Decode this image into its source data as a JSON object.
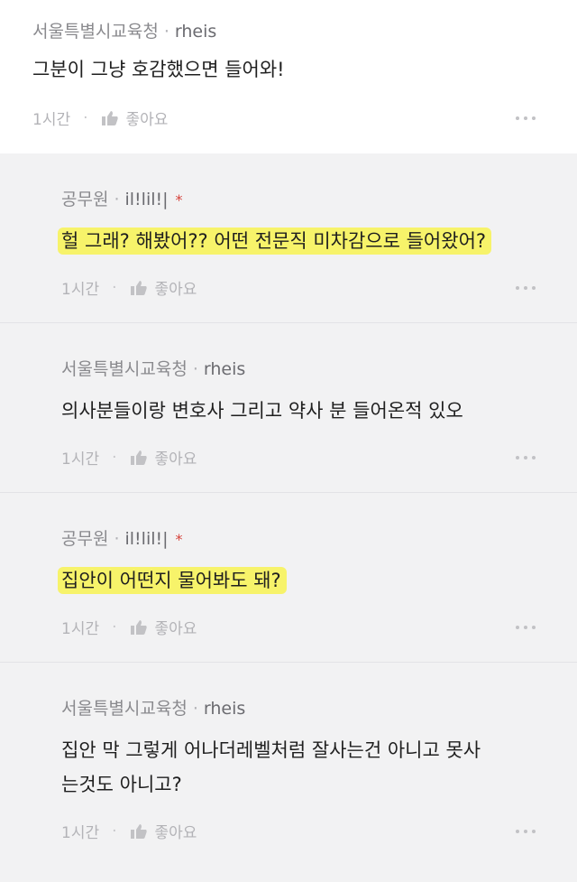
{
  "post": {
    "author": "서울특별시교육청",
    "user_id": "rheis",
    "text": "그분이 그냥 호감했으면 들어와!",
    "time": "1시간",
    "like_label": "좋아요"
  },
  "replies": [
    {
      "author": "공무원",
      "user_id": "il!lil!|",
      "star": "*",
      "text": "헐 그래? 해봤어?? 어떤 전문직 미차감으로 들어왔어?",
      "time": "1시간",
      "like_label": "좋아요"
    },
    {
      "author": "서울특별시교육청",
      "user_id": "rheis",
      "text": "의사분들이랑 변호사 그리고 약사 분 들어온적 있오",
      "time": "1시간",
      "like_label": "좋아요"
    },
    {
      "author": "공무원",
      "user_id": "il!lil!|",
      "star": "*",
      "text": "집안이 어떤지 물어봐도 돼?",
      "time": "1시간",
      "like_label": "좋아요"
    },
    {
      "author": "서울특별시교육청",
      "user_id": "rheis",
      "text_line1": "집안 막 그렇게 어나더레벨처럼 잘사는건 아니고 못사",
      "text_line2": "는것도 아니고?",
      "time": "1시간",
      "like_label": "좋아요"
    }
  ],
  "icons": {
    "like": "thumbs-up-icon",
    "more": "more-dots-icon"
  },
  "colors": {
    "highlight": "#f7f36a",
    "star": "#d6423a",
    "background": "#f2f2f3"
  },
  "separator": "·"
}
